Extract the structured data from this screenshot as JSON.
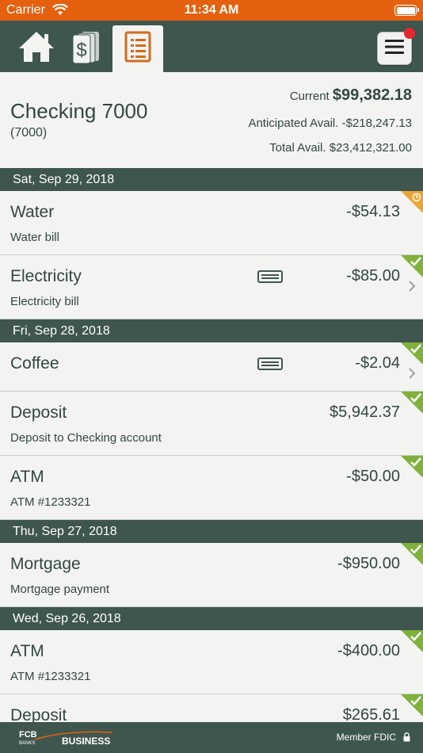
{
  "status_bar": {
    "carrier": "Carrier",
    "time": "11:34 AM"
  },
  "nav": {
    "tabs": [
      {
        "icon": "home-icon"
      },
      {
        "icon": "dollar-icon"
      },
      {
        "icon": "register-icon",
        "active": true
      }
    ],
    "menu_icon": "hamburger-menu-icon"
  },
  "account": {
    "name": "Checking 7000",
    "number": "(7000)",
    "current_label": "Current",
    "current_value": "$99,382.18",
    "anticipated": "Anticipated Avail. -$218,247.13",
    "total": "Total Avail. $23,412,321.00"
  },
  "groups": [
    {
      "date": "Sat, Sep 29, 2018",
      "transactions": [
        {
          "name": "Water",
          "sub": "Water bill",
          "amount": "-$54.13",
          "status": "pending"
        },
        {
          "name": "Electricity",
          "sub": "Electricity bill",
          "amount": "-$85.00",
          "status": "cleared",
          "card": true,
          "chevron": true
        }
      ]
    },
    {
      "date": "Fri, Sep 28, 2018",
      "transactions": [
        {
          "name": "Coffee",
          "sub": "",
          "amount": "-$2.04",
          "status": "cleared",
          "card": true,
          "chevron": true
        },
        {
          "name": "Deposit",
          "sub": "Deposit to Checking account",
          "amount": "$5,942.37",
          "status": "cleared"
        },
        {
          "name": "ATM",
          "sub": "ATM #1233321",
          "amount": "-$50.00",
          "status": "cleared"
        }
      ]
    },
    {
      "date": "Thu, Sep 27, 2018",
      "transactions": [
        {
          "name": "Mortgage",
          "sub": "Mortgage payment",
          "amount": "-$950.00",
          "status": "cleared"
        }
      ]
    },
    {
      "date": "Wed, Sep 26, 2018",
      "transactions": [
        {
          "name": "ATM",
          "sub": "ATM #1233321",
          "amount": "-$400.00",
          "status": "cleared"
        },
        {
          "name": "Deposit",
          "sub": "",
          "amount": "$265.61",
          "status": "cleared"
        }
      ]
    }
  ],
  "footer": {
    "logo_top": "FCB",
    "logo_small": "BANKS",
    "logo_brand": "BUSINESS",
    "fdic": "Member FDIC",
    "lock_icon": "lock-icon"
  },
  "colors": {
    "status_bar": "#e5610f",
    "header": "#3e564e",
    "text": "#33463f",
    "cleared": "#7fb13c",
    "pending": "#eba536",
    "badge": "#e8262e"
  }
}
